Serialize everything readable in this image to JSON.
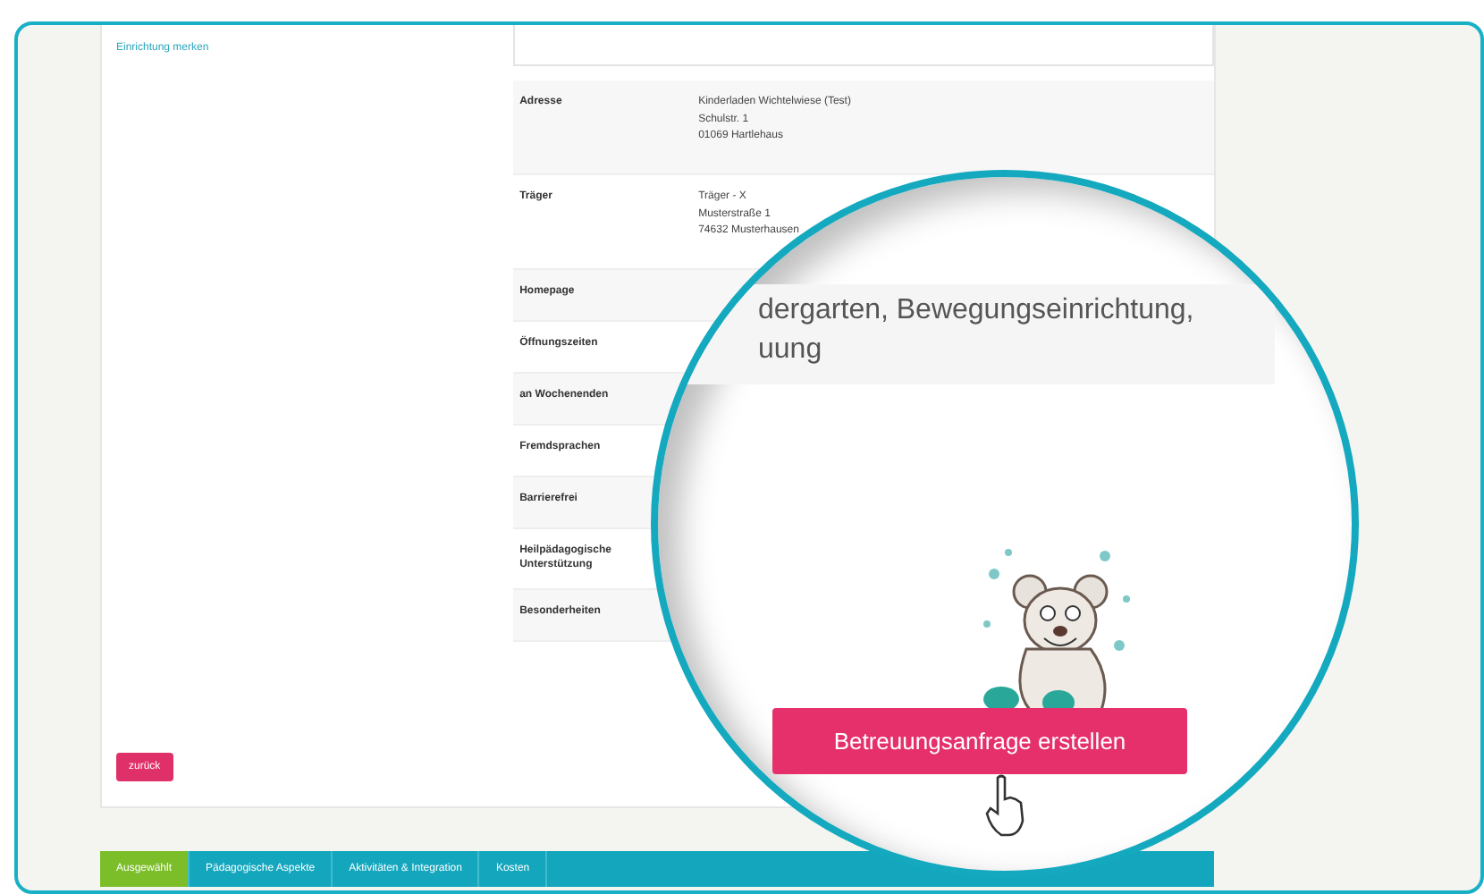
{
  "sidebar": {
    "link": "Einrichtung merken",
    "back_button": "zurück"
  },
  "details": [
    {
      "label": "Adresse",
      "lines": [
        "Kinderladen Wichtelwiese (Test)",
        "Schulstr. 1",
        "01069 Hartlehaus"
      ]
    },
    {
      "label": "Träger",
      "lines": [
        "Träger - X",
        "Musterstraße 1",
        "74632 Musterhausen"
      ]
    },
    {
      "label": "Homepage"
    },
    {
      "label": "Öffnungszeiten"
    },
    {
      "label": "an Wochenenden"
    },
    {
      "label": "Fremdsprachen"
    },
    {
      "label": "Barrierefrei"
    },
    {
      "label": "Heilpädagogische Unterstützung"
    },
    {
      "label": "Besonderheiten"
    }
  ],
  "magnifier": {
    "text_lines": [
      "dergarten, Bewegungseinrichtung,",
      "uung"
    ],
    "button": "Betreuungsanfrage erstellen"
  },
  "tabs": [
    {
      "label": "Ausgewählt",
      "selected": true
    },
    {
      "label": "Pädagogische Aspekte",
      "selected": false
    },
    {
      "label": "Aktivitäten & Integration",
      "selected": false
    },
    {
      "label": "Kosten",
      "selected": false
    }
  ]
}
